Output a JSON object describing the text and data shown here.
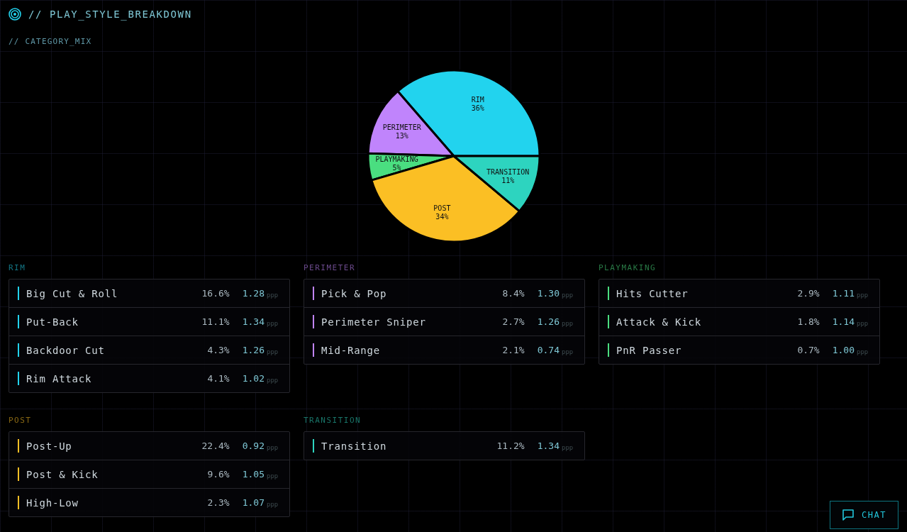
{
  "header": {
    "title": "// PLAY_STYLE_BREAKDOWN"
  },
  "category_mix": {
    "label": "// CATEGORY_MIX",
    "chart_data": {
      "type": "pie",
      "categories": [
        "RIM",
        "PERIMETER",
        "PLAYMAKING",
        "POST",
        "TRANSITION"
      ],
      "values": [
        36,
        13,
        5,
        34,
        11
      ],
      "value_labels": [
        "36%",
        "13%",
        "5%",
        "34%",
        "11%"
      ]
    }
  },
  "groups": [
    {
      "title": "RIM",
      "color": "#22d3ee",
      "rows": [
        {
          "name": "Big Cut & Roll",
          "share": "16.6%",
          "ppp": "1.28",
          "unit": "ppp"
        },
        {
          "name": "Put-Back",
          "share": "11.1%",
          "ppp": "1.34",
          "unit": "ppp"
        },
        {
          "name": "Backdoor Cut",
          "share": "4.3%",
          "ppp": "1.26",
          "unit": "ppp"
        },
        {
          "name": "Rim Attack",
          "share": "4.1%",
          "ppp": "1.02",
          "unit": "ppp"
        }
      ]
    },
    {
      "title": "PERIMETER",
      "color": "#c084fc",
      "rows": [
        {
          "name": "Pick & Pop",
          "share": "8.4%",
          "ppp": "1.30",
          "unit": "ppp"
        },
        {
          "name": "Perimeter Sniper",
          "share": "2.7%",
          "ppp": "1.26",
          "unit": "ppp"
        },
        {
          "name": "Mid-Range",
          "share": "2.1%",
          "ppp": "0.74",
          "unit": "ppp"
        }
      ]
    },
    {
      "title": "PLAYMAKING",
      "color": "#4ade80",
      "rows": [
        {
          "name": "Hits Cutter",
          "share": "2.9%",
          "ppp": "1.11",
          "unit": "ppp"
        },
        {
          "name": "Attack & Kick",
          "share": "1.8%",
          "ppp": "1.14",
          "unit": "ppp"
        },
        {
          "name": "PnR Passer",
          "share": "0.7%",
          "ppp": "1.00",
          "unit": "ppp"
        }
      ]
    },
    {
      "title": "POST",
      "color": "#fbbf24",
      "rows": [
        {
          "name": "Post-Up",
          "share": "22.4%",
          "ppp": "0.92",
          "unit": "ppp"
        },
        {
          "name": "Post & Kick",
          "share": "9.6%",
          "ppp": "1.05",
          "unit": "ppp"
        },
        {
          "name": "High-Low",
          "share": "2.3%",
          "ppp": "1.07",
          "unit": "ppp"
        }
      ]
    },
    {
      "title": "TRANSITION",
      "color": "#2dd4bf",
      "rows": [
        {
          "name": "Transition",
          "share": "11.2%",
          "ppp": "1.34",
          "unit": "ppp"
        }
      ]
    }
  ],
  "chat_button": {
    "label": "CHAT"
  }
}
